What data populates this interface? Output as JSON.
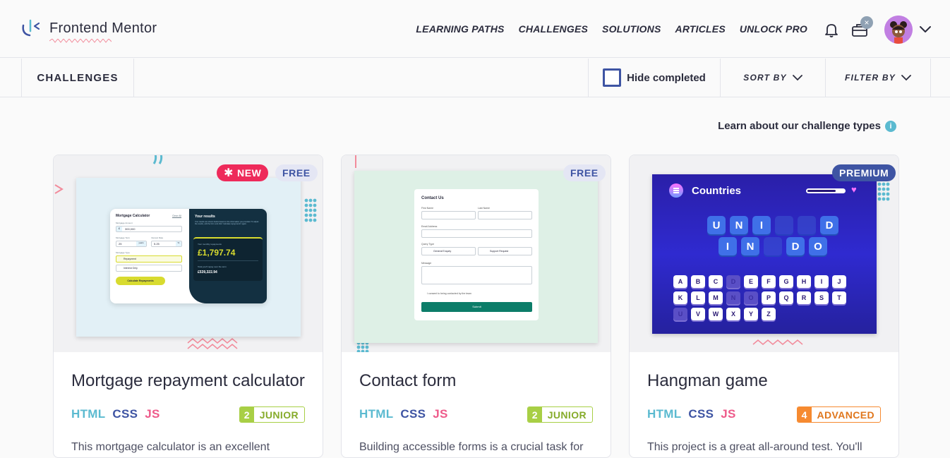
{
  "header": {
    "logo_text": "Frontend Mentor",
    "nav": [
      "LEARNING PATHS",
      "CHALLENGES",
      "SOLUTIONS",
      "ARTICLES",
      "UNLOCK PRO"
    ]
  },
  "subbar": {
    "title": "CHALLENGES",
    "hide_completed": "Hide completed",
    "sort_by": "SORT BY",
    "filter_by": "FILTER BY"
  },
  "learn_link": "Learn about our challenge types",
  "cards": [
    {
      "title": "Mortgage repayment calculator",
      "tags": [
        "NEW",
        "FREE"
      ],
      "langs": [
        "HTML",
        "CSS",
        "JS"
      ],
      "level_num": "2",
      "level_name": "JUNIOR",
      "level_color": "#a8cf45",
      "desc": "This mortgage calculator is an excellent",
      "preview": {
        "heading": "Mortgage Calculator",
        "clear_all": "Clear All",
        "amount_label": "Mortgage Amount",
        "amount_prefix": "£",
        "amount_value": "300,000",
        "term_label": "Mortgage Term",
        "term_value": "25",
        "term_unit": "years",
        "rate_label": "Interest Rate",
        "rate_value": "5.25",
        "rate_unit": "%",
        "type_label": "Mortgage Type",
        "type_options": [
          "Repayment",
          "Interest Only"
        ],
        "button": "Calculate Repayments",
        "results_title": "Your results",
        "results_text": "Your results are shown below based on the information you provided. To adjust the results, edit the form and click \"calculate repayments\" again.",
        "monthly_label": "Your monthly repayments",
        "monthly_value": "£1,797.74",
        "total_label": "Total you'll repay over the term",
        "total_value": "£539,322.94"
      }
    },
    {
      "title": "Contact form",
      "tags": [
        "FREE"
      ],
      "langs": [
        "HTML",
        "CSS",
        "JS"
      ],
      "level_num": "2",
      "level_name": "JUNIOR",
      "level_color": "#a8cf45",
      "desc": "Building accessible forms is a crucial task for",
      "preview": {
        "heading": "Contact Us",
        "first_name": "First Name",
        "last_name": "Last Name",
        "email": "Email Address",
        "query_type": "Query Type",
        "query_options": [
          "General Enquiry",
          "Support Request"
        ],
        "message": "Message",
        "consent": "I consent to being contacted by the team",
        "submit": "Submit"
      }
    },
    {
      "title": "Hangman game",
      "tags": [
        "PREMIUM"
      ],
      "langs": [
        "HTML",
        "CSS",
        "JS"
      ],
      "level_num": "4",
      "level_name": "ADVANCED",
      "level_color": "#f68a30",
      "desc": "This project is a great all-around test. You'll",
      "preview": {
        "heading": "Countries",
        "row1": [
          "U",
          "N",
          "I",
          "",
          "",
          "D"
        ],
        "row2": [
          "I",
          "N",
          "",
          "D",
          "O"
        ],
        "keys": [
          "A",
          "B",
          "C",
          "D",
          "E",
          "F",
          "G",
          "H",
          "I",
          "J",
          "K",
          "L",
          "M",
          "N",
          "O",
          "P",
          "Q",
          "R",
          "S",
          "T",
          "U",
          "V",
          "W",
          "X",
          "Y",
          "Z"
        ],
        "used_keys": [
          "D",
          "I",
          "N",
          "O",
          "U"
        ]
      }
    }
  ]
}
